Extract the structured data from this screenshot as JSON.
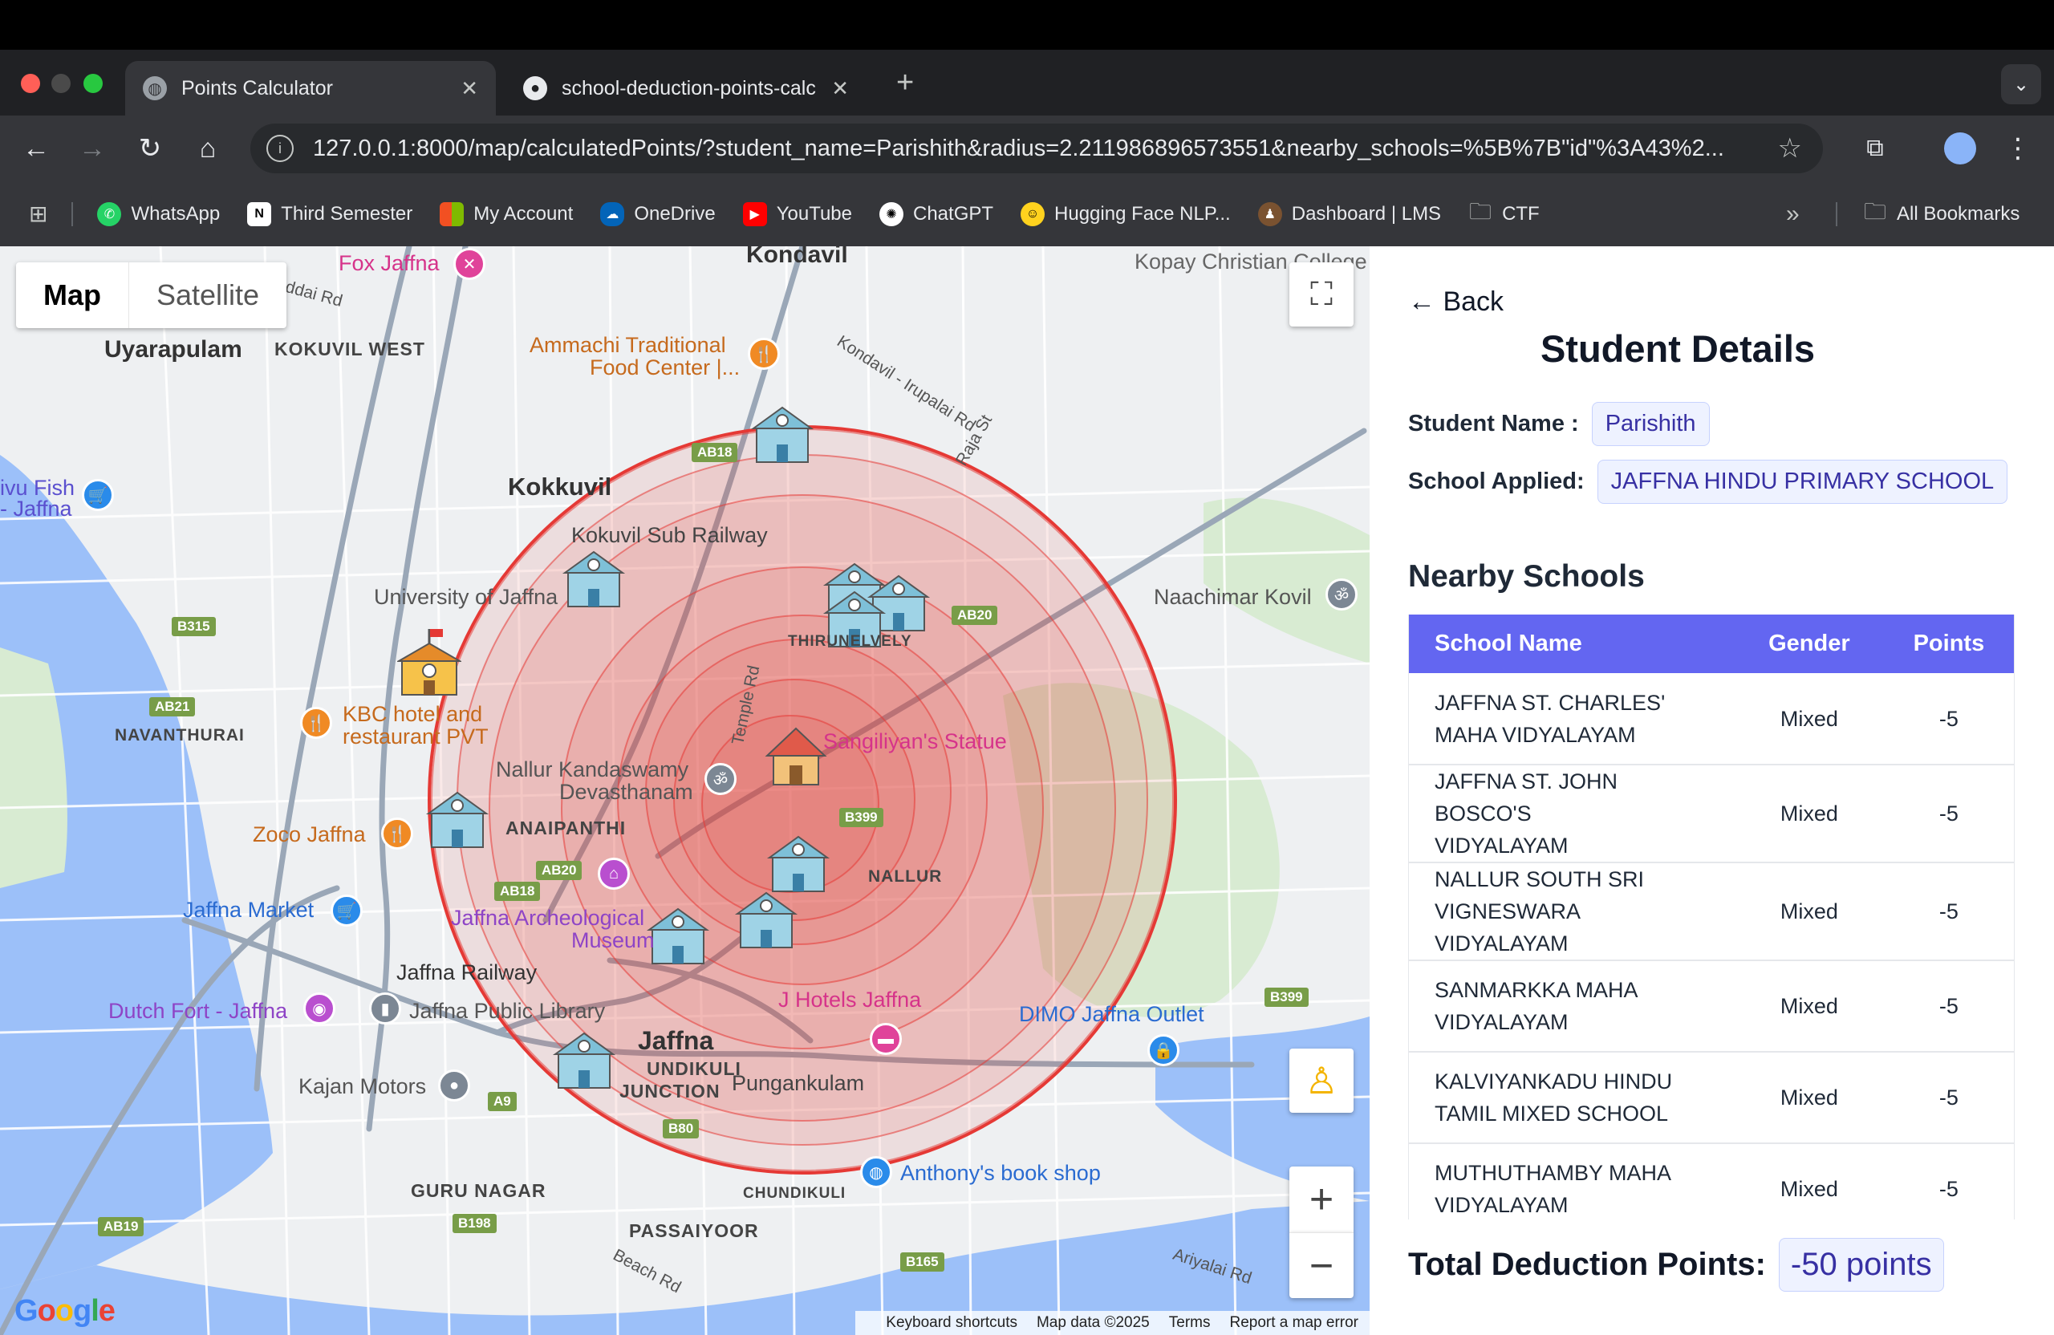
{
  "browser": {
    "tabs": [
      {
        "title": "Points Calculator",
        "icon": "globe-icon",
        "active": true
      },
      {
        "title": "school-deduction-points-calc",
        "icon": "github-icon",
        "active": false
      }
    ],
    "url": "127.0.0.1:8000/map/calculatedPoints/?student_name=Parishith&radius=2.211986896573551&nearby_schools=%5B%7B\"id\"%3A43%2...",
    "bookmarks": [
      "WhatsApp",
      "Third Semester",
      "My Account",
      "OneDrive",
      "YouTube",
      "ChatGPT",
      "Hugging Face NLP...",
      "Dashboard | LMS",
      "CTF"
    ],
    "all_bookmarks": "All Bookmarks",
    "more_bookmarks": "»"
  },
  "map": {
    "type_map": "Map",
    "type_satellite": "Satellite",
    "labels": {
      "kondavil": "Kondavil",
      "fox": "Fox Jaffna",
      "uyarapulam": "Uyarapulam",
      "kokuvil_west": "KOKUVIL WEST",
      "ammachi1": "Ammachi Traditional",
      "ammachi2": "Food Center |...",
      "kopay": "Kopay Christian College",
      "kondavil_rd": "Kondavil - Irupalai Rd",
      "raja_st": "Raja St",
      "kokkuvil": "Kokkuvil",
      "kokuvil_rail": "Kokuvil Sub Railway",
      "uni": "University of Jaffna",
      "naachimar": "Naachimar Kovil",
      "ivu1": "ivu Fish",
      "ivu2": "- Jaffna",
      "navanthurai": "NAVANTHURAI",
      "kbc1": "KBC hotel and",
      "kbc2": "restaurant PVT",
      "sangiliyan": "Sangiliyan's Statue",
      "temple_rd": "Temple Rd",
      "nallur1": "Nallur Kandaswamy",
      "nallur2": "Devasthanam",
      "anaipanthi": "ANAIPANTHI",
      "zoco": "Zoco Jaffna",
      "nallur": "NALLUR",
      "jaffna_market": "Jaffna Market",
      "arch1": "Jaffna Archeological",
      "arch2": "Museum",
      "jaffna_railway": "Jaffna Railway",
      "dutch": "Dutch Fort - Jaffna",
      "library": "Jaffna Public Library",
      "jhotels": "J Hotels Jaffna",
      "dimo": "DIMO Jaffna Outlet",
      "jaffna": "Jaffna",
      "kajan": "Kajan Motors",
      "mundikuli1": "UNDIKULI",
      "mundikuli2": "JUNCTION",
      "pungankulam": "Pungankulam",
      "anthony": "Anthony's book shop",
      "guru": "GURU NAGAR",
      "chundikuli": "CHUNDIKULI",
      "passaiyoor": "PASSAIYOOR",
      "beach_rd": "Beach Rd",
      "ariyalai": "Ariyalai Rd",
      "thirunelvely": "THIRUNELVELY",
      "kokuvil_partial": "ddai Rd"
    },
    "road_badges": [
      "AB18",
      "AB20",
      "B315",
      "AB21",
      "B399",
      "AB20",
      "AB18",
      "A9",
      "B80",
      "B198",
      "AB19",
      "B165",
      "B399"
    ],
    "footer": [
      "Keyboard shortcuts",
      "Map data ©2025",
      "Terms",
      "Report a map error"
    ],
    "google": "Google",
    "zoom_in": "+",
    "zoom_out": "−"
  },
  "panel": {
    "back": "Back",
    "title": "Student Details",
    "student_name_label": "Student Name :",
    "student_name": "Parishith",
    "school_applied_label": "School Applied:",
    "school_applied": "JAFFNA HINDU PRIMARY SCHOOL",
    "nearby_heading": "Nearby Schools",
    "table": {
      "headers": [
        "School Name",
        "Gender",
        "Points"
      ],
      "rows": [
        {
          "line1": "JAFFNA ST. CHARLES'",
          "line2": "MAHA VIDYALAYAM",
          "gender": "Mixed",
          "points": "-5"
        },
        {
          "line1": "JAFFNA ST. JOHN BOSCO'S",
          "line2": "VIDYALAYAM",
          "gender": "Mixed",
          "points": "-5"
        },
        {
          "line1": "NALLUR SOUTH SRI",
          "line2": "VIGNESWARA VIDYALAYAM",
          "gender": "Mixed",
          "points": "-5"
        },
        {
          "line1": "SANMARKKA MAHA",
          "line2": "VIDYALAYAM",
          "gender": "Mixed",
          "points": "-5"
        },
        {
          "line1": "KALVIYANKADU HINDU",
          "line2": "TAMIL MIXED SCHOOL",
          "gender": "Mixed",
          "points": "-5"
        },
        {
          "line1": "MUTHUTHAMBY MAHA",
          "line2": "VIDYALAYAM",
          "gender": "Mixed",
          "points": "-5"
        }
      ]
    },
    "total_label": "Total Deduction Points:",
    "total_value": "-50 points"
  },
  "colors": {
    "accent": "#6366f1",
    "circle": "#e53935",
    "pill_bg": "#eef2ff",
    "pill_text": "#3730a3"
  }
}
